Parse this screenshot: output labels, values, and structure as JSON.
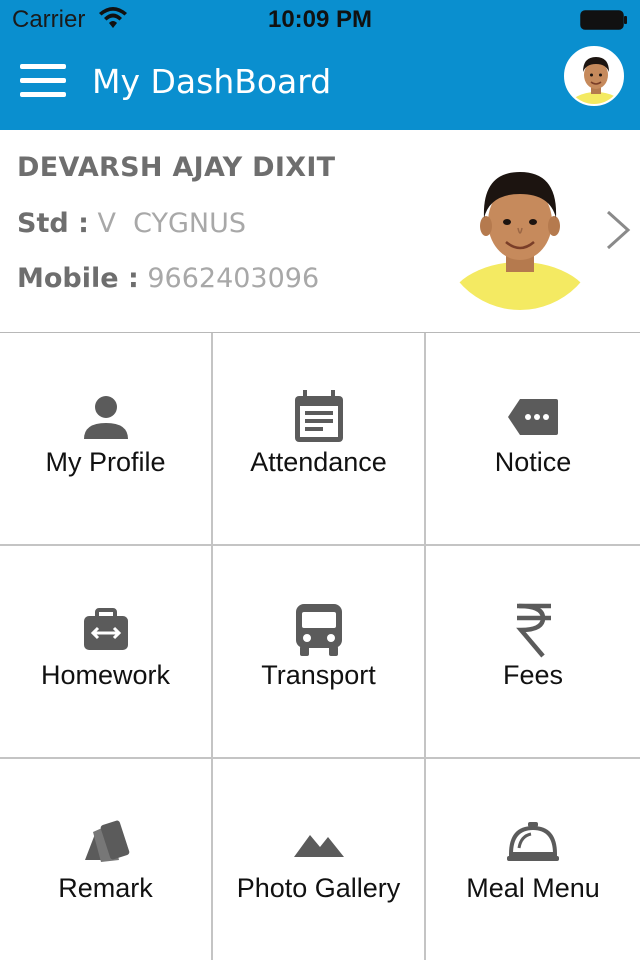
{
  "status_bar": {
    "carrier": "Carrier",
    "time": "10:09 PM",
    "icons": [
      "wifi-icon",
      "battery-icon"
    ]
  },
  "header": {
    "title": "My DashBoard",
    "menu_icon": "hamburger-menu-icon",
    "accent_color": "#0a8fcf"
  },
  "profile": {
    "name": "DEVARSH AJAY DIXIT",
    "std_label": "Std :",
    "std_value": "V  CYGNUS",
    "mobile_label": "Mobile :",
    "mobile_value": "9662403096"
  },
  "menu": [
    {
      "label": "My Profile",
      "icon": "person-icon"
    },
    {
      "label": "Attendance",
      "icon": "calendar-icon"
    },
    {
      "label": "Notice",
      "icon": "notice-tag-icon"
    },
    {
      "label": "Homework",
      "icon": "briefcase-icon"
    },
    {
      "label": "Transport",
      "icon": "bus-icon"
    },
    {
      "label": "Fees",
      "icon": "rupee-icon"
    },
    {
      "label": "Remark",
      "icon": "cards-icon"
    },
    {
      "label": "Photo Gallery",
      "icon": "mountains-icon"
    },
    {
      "label": "Meal Menu",
      "icon": "cloche-icon"
    }
  ]
}
